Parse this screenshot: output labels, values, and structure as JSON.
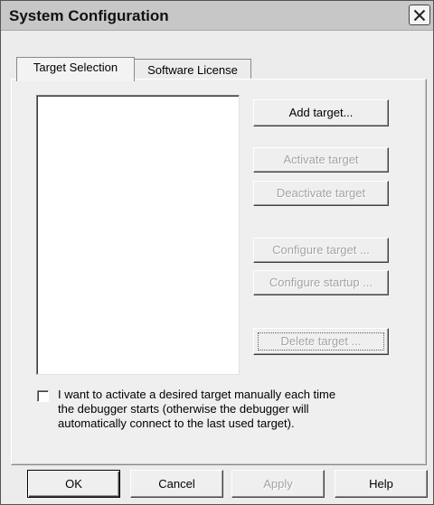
{
  "window": {
    "title": "System Configuration"
  },
  "tabs": [
    {
      "label": "Target Selection",
      "active": true
    },
    {
      "label": "Software License",
      "active": false
    }
  ],
  "target_list": {
    "items": []
  },
  "target_buttons": {
    "add": {
      "label": "Add target...",
      "enabled": true
    },
    "activate": {
      "label": "Activate target",
      "enabled": false
    },
    "deactivate": {
      "label": "Deactivate target",
      "enabled": false
    },
    "configure": {
      "label": "Configure target ...",
      "enabled": false
    },
    "configure_startup": {
      "label": "Configure startup ...",
      "enabled": false
    },
    "delete": {
      "label": "Delete target ...",
      "enabled": false
    }
  },
  "manual_activation": {
    "checked": false,
    "line1": "I want to activate a desired target manually each time",
    "line2": "the debugger starts (otherwise the debugger will",
    "line3": "automatically connect to the last used target)."
  },
  "dialog_buttons": {
    "ok": {
      "label": "OK",
      "enabled": true
    },
    "cancel": {
      "label": "Cancel",
      "enabled": true
    },
    "apply": {
      "label": "Apply",
      "enabled": false
    },
    "help": {
      "label": "Help",
      "enabled": true
    }
  }
}
